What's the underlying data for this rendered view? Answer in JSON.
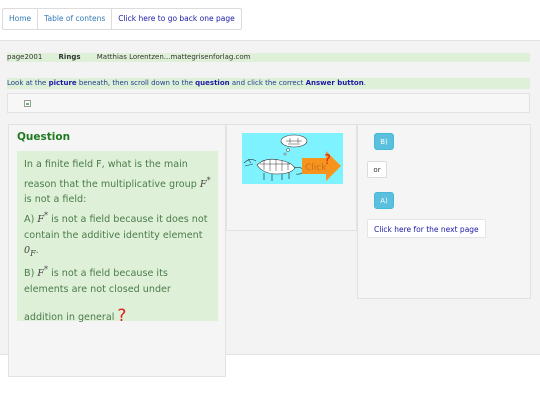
{
  "nav": {
    "home": "Home",
    "toc": "Table of contens",
    "back": "Click here to go back one page"
  },
  "crumb": {
    "page": "page2001",
    "topic": "Rings",
    "author": "Matthias Lorentzen...mattegrisenforlag.com"
  },
  "instruction": {
    "t1": "Look at the ",
    "b1": "picture",
    "t2": " beneath, then scroll down to the ",
    "b2": "question",
    "t3": " and click the correct ",
    "b3": "Answer button",
    "t4": "."
  },
  "question": {
    "title": "Question",
    "line1": "In a finite field F, what is the main reason that the multiplicative group",
    "sym": "F",
    "sup": "*",
    "line1b": " is not a field:",
    "optA_prefix": "A) ",
    "optA_text": " is not a field because it does not contain the additive identity element ",
    "zero": "0",
    "zero_sub": "F",
    "optA_end": ".",
    "optB_prefix": "B) ",
    "optB_text": " is not a field because its elements are not closed under",
    "optB_end": "addition in general",
    "qmark": "?"
  },
  "picture": {
    "click_label": "Click",
    "qmark": "?",
    "colors": {
      "bg": "#7ff2ff",
      "arrow": "#f7941d",
      "qmark": "#e0201a"
    }
  },
  "answers": {
    "b": "B)",
    "or": "or",
    "a": "A)",
    "next": "Click here for the next page"
  },
  "colors": {
    "link": "#337ab7",
    "green_panel": "#dff0d8",
    "question_title": "#1f7a1f",
    "answer_button": "#5bc0de"
  }
}
